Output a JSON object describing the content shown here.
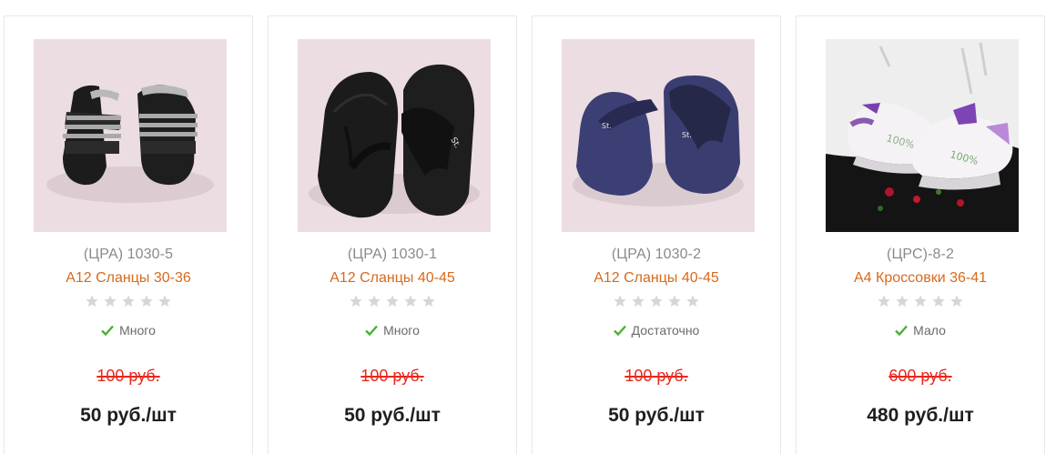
{
  "products": [
    {
      "sku": "(ЦРА) 1030-5",
      "title": "А12 Сланцы 30-36",
      "rating": 0,
      "stock_label": "Много",
      "old_price": "100 руб.",
      "price": "50 руб./шт",
      "image_icon": "black-grey-slide-sandals"
    },
    {
      "sku": "(ЦРА) 1030-1",
      "title": "А12 Сланцы 40-45",
      "rating": 0,
      "stock_label": "Много",
      "old_price": "100 руб.",
      "price": "50 руб./шт",
      "image_icon": "black-flip-flops"
    },
    {
      "sku": "(ЦРА) 1030-2",
      "title": "А12 Сланцы 40-45",
      "rating": 0,
      "stock_label": "Достаточно",
      "old_price": "100 руб.",
      "price": "50 руб./шт",
      "image_icon": "navy-flip-flops"
    },
    {
      "sku": "(ЦРС)-8-2",
      "title": "А4 Кроссовки 36-41",
      "rating": 0,
      "stock_label": "Мало",
      "old_price": "600 руб.",
      "price": "480 руб./шт",
      "image_icon": "white-purple-sneakers"
    }
  ],
  "colors": {
    "title": "#d9691c",
    "old_price": "#e8281c",
    "check": "#4caf3a",
    "star_empty": "#d6d6d6"
  }
}
